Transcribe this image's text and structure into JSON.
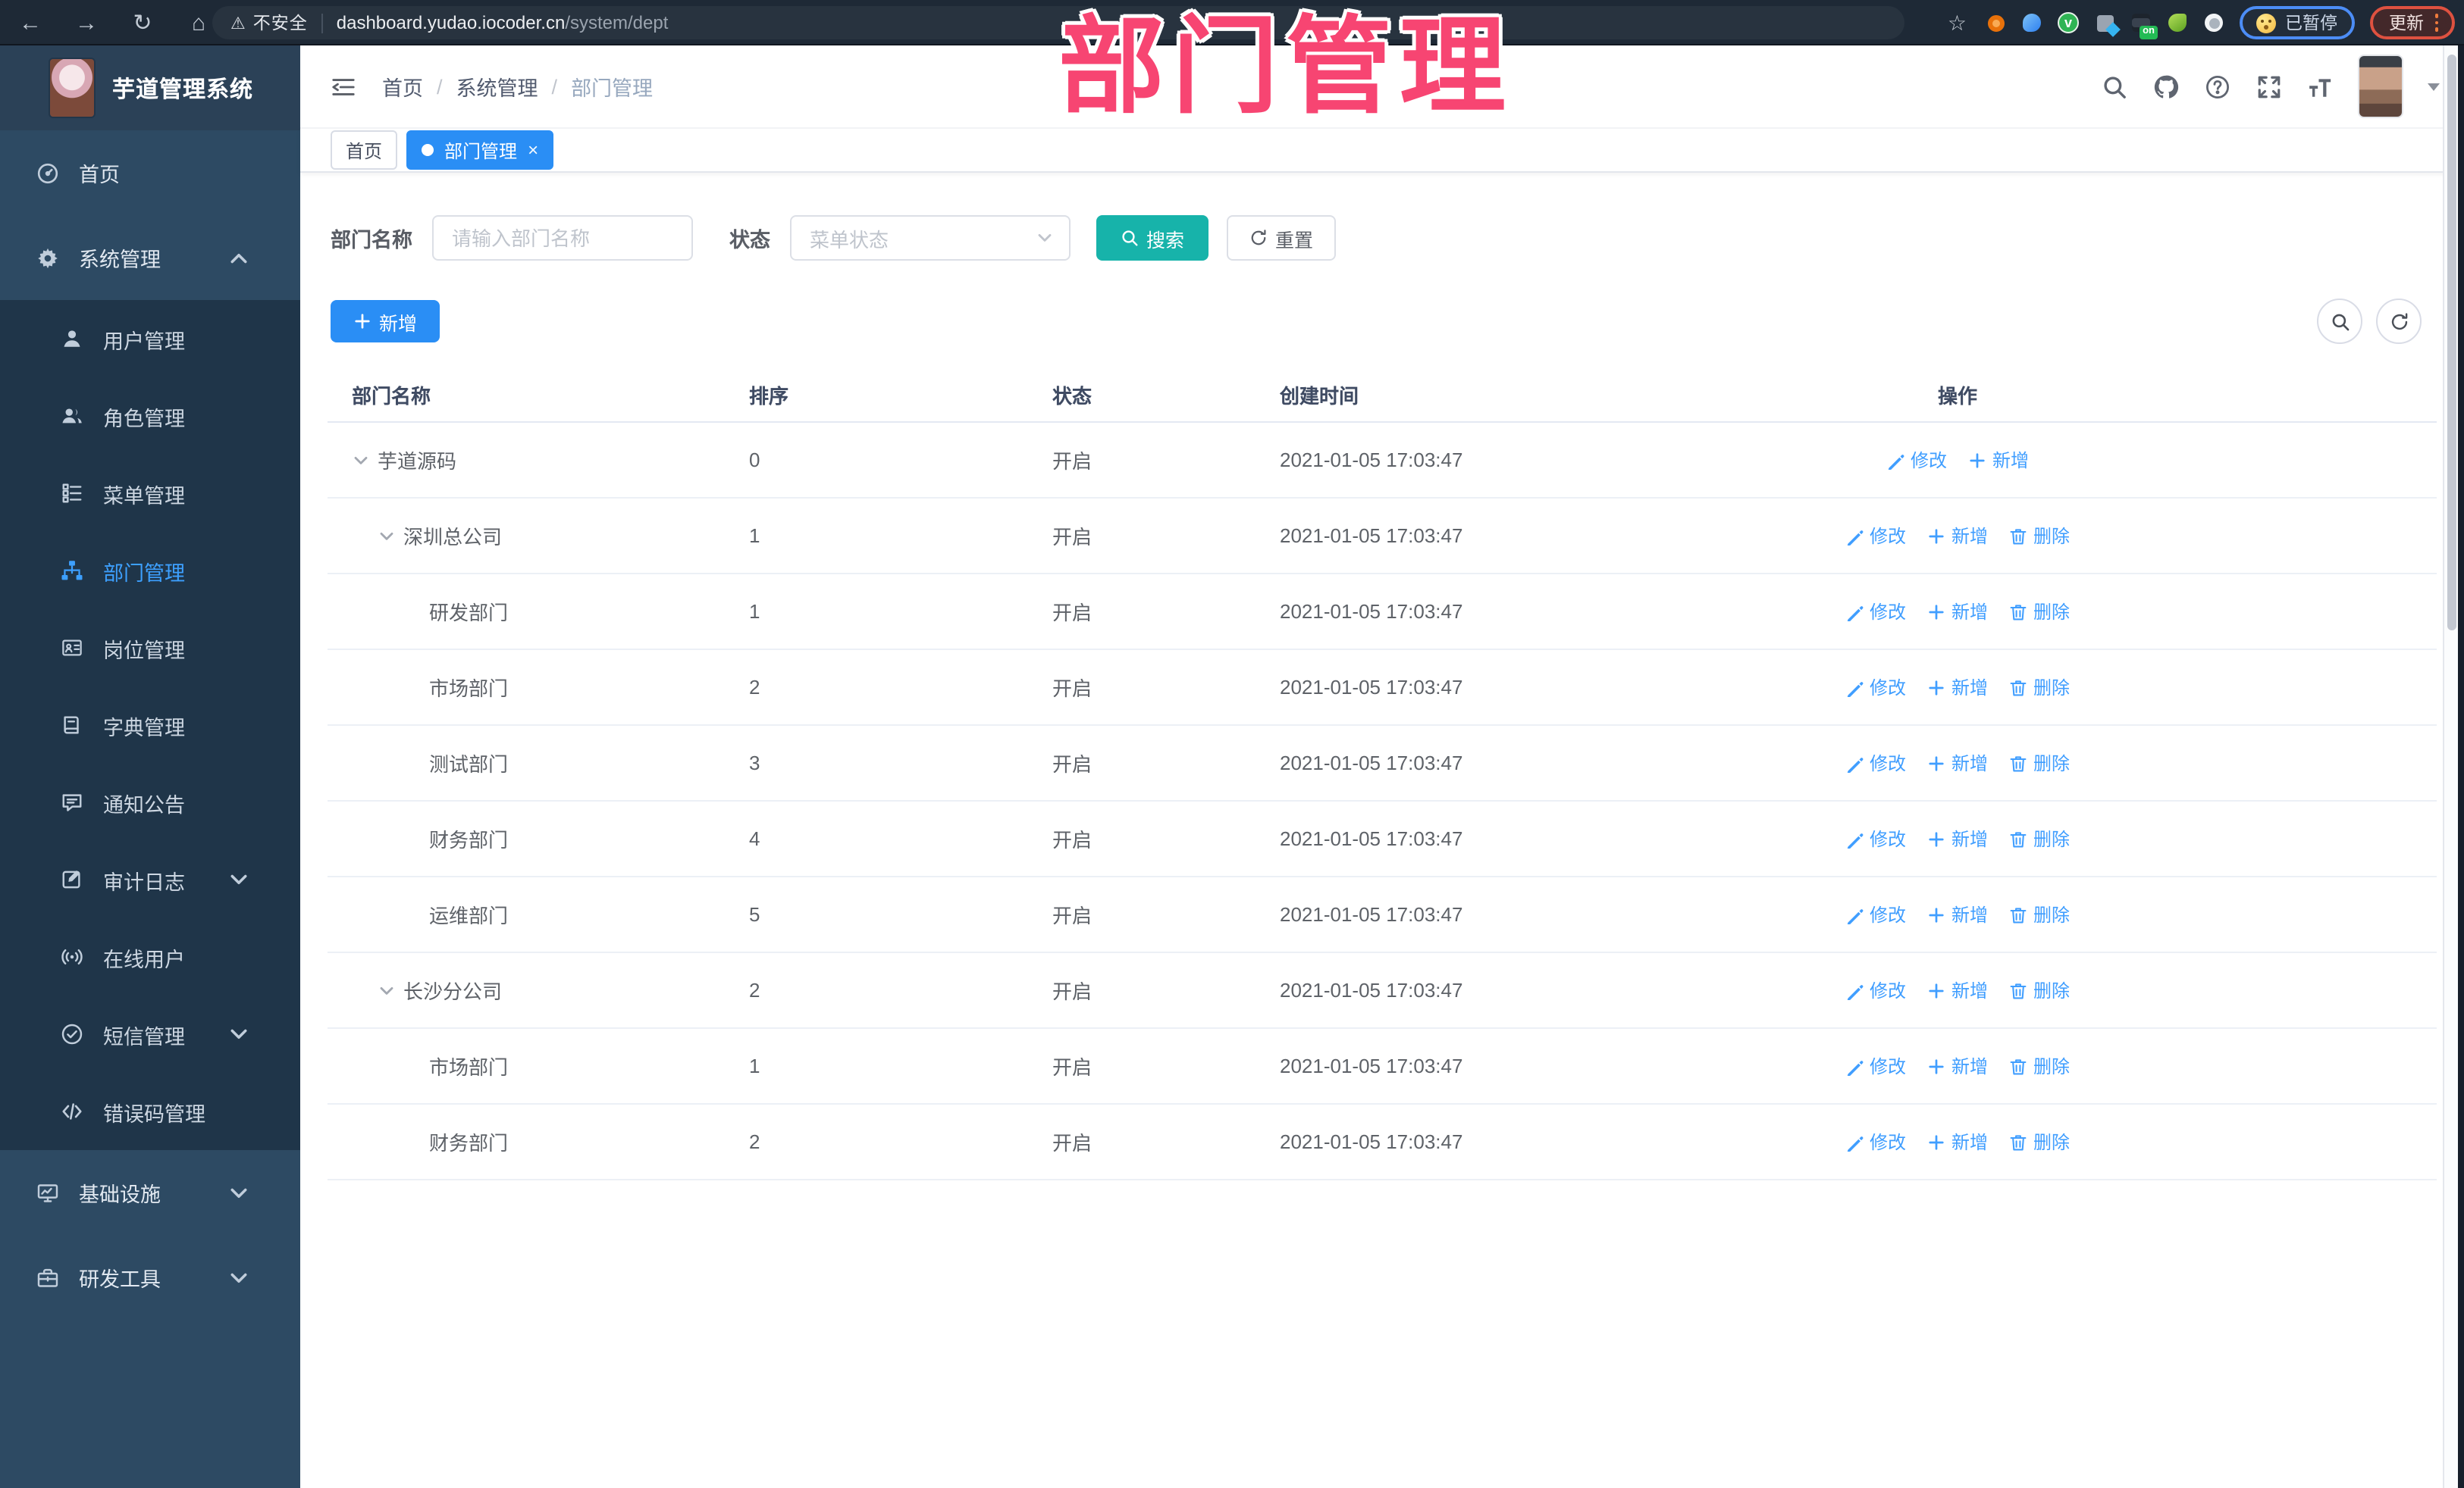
{
  "browser": {
    "security_label": "不安全",
    "url_host": "dashboard.yudao.iocoder.cn",
    "url_path": "/system/dept",
    "extensions": [
      "orange-ring-extension-icon",
      "blue-drop-extension-icon",
      "green-check-extension-icon",
      "grid-blue-extension-icon",
      "dark-on-extension-icon",
      "green-leaf-extension-icon",
      "white-paw-extension-icon"
    ],
    "on_badge": "on",
    "green_check_glyph": "v",
    "paused_label": "已暂停",
    "update_label": "更新"
  },
  "annotation": {
    "text": "部门管理",
    "color": "#f74572"
  },
  "sidebar": {
    "logo_title": "芋道管理系统",
    "items": [
      {
        "name": "home",
        "label": "首页",
        "icon": "dashboard-icon",
        "level": "top"
      },
      {
        "name": "system-management",
        "label": "系统管理",
        "icon": "gear-icon",
        "level": "top",
        "arrow": "up"
      },
      {
        "name": "user-management",
        "label": "用户管理",
        "icon": "user-icon",
        "level": "sub"
      },
      {
        "name": "role-management",
        "label": "角色管理",
        "icon": "users-icon",
        "level": "sub"
      },
      {
        "name": "menu-management",
        "label": "菜单管理",
        "icon": "menu-list-icon",
        "level": "sub"
      },
      {
        "name": "dept-management",
        "label": "部门管理",
        "icon": "org-tree-icon",
        "level": "sub",
        "active": true
      },
      {
        "name": "post-management",
        "label": "岗位管理",
        "icon": "badge-icon",
        "level": "sub"
      },
      {
        "name": "dict-management",
        "label": "字典管理",
        "icon": "dictionary-icon",
        "level": "sub"
      },
      {
        "name": "notice-announcement",
        "label": "通知公告",
        "icon": "announcement-icon",
        "level": "sub"
      },
      {
        "name": "audit-log",
        "label": "审计日志",
        "icon": "audit-log-icon",
        "level": "sub",
        "arrow": "down"
      },
      {
        "name": "online-users",
        "label": "在线用户",
        "icon": "online-user-icon",
        "level": "sub"
      },
      {
        "name": "sms-management",
        "label": "短信管理",
        "icon": "sms-icon",
        "level": "sub",
        "arrow": "down"
      },
      {
        "name": "error-code-management",
        "label": "错误码管理",
        "icon": "error-code-icon",
        "level": "sub"
      },
      {
        "name": "infrastructure",
        "label": "基础设施",
        "icon": "infrastructure-icon",
        "level": "top",
        "arrow": "down"
      },
      {
        "name": "dev-tools",
        "label": "研发工具",
        "icon": "dev-tools-icon",
        "level": "top",
        "arrow": "down"
      }
    ]
  },
  "header": {
    "breadcrumb": [
      "首页",
      "系统管理",
      "部门管理"
    ]
  },
  "tabs": [
    {
      "name": "home",
      "label": "首页",
      "active": false,
      "closable": false
    },
    {
      "name": "dept-management",
      "label": "部门管理",
      "active": true,
      "closable": true
    }
  ],
  "filters": {
    "dept_name_label": "部门名称",
    "dept_name_placeholder": "请输入部门名称",
    "status_label": "状态",
    "status_placeholder": "菜单状态",
    "search_label": "搜索",
    "reset_label": "重置"
  },
  "toolbar": {
    "add_label": "新增"
  },
  "table": {
    "columns": [
      "部门名称",
      "排序",
      "状态",
      "创建时间",
      "操作"
    ],
    "action_labels": {
      "edit": "修改",
      "add": "新增",
      "delete": "删除"
    },
    "rows": [
      {
        "name": "芋道源码",
        "level": 0,
        "expandable": true,
        "sort": "0",
        "status": "开启",
        "created": "2021-01-05 17:03:47",
        "actions": [
          "edit",
          "add"
        ]
      },
      {
        "name": "深圳总公司",
        "level": 1,
        "expandable": true,
        "sort": "1",
        "status": "开启",
        "created": "2021-01-05 17:03:47",
        "actions": [
          "edit",
          "add",
          "delete"
        ]
      },
      {
        "name": "研发部门",
        "level": 2,
        "expandable": false,
        "sort": "1",
        "status": "开启",
        "created": "2021-01-05 17:03:47",
        "actions": [
          "edit",
          "add",
          "delete"
        ]
      },
      {
        "name": "市场部门",
        "level": 2,
        "expandable": false,
        "sort": "2",
        "status": "开启",
        "created": "2021-01-05 17:03:47",
        "actions": [
          "edit",
          "add",
          "delete"
        ]
      },
      {
        "name": "测试部门",
        "level": 2,
        "expandable": false,
        "sort": "3",
        "status": "开启",
        "created": "2021-01-05 17:03:47",
        "actions": [
          "edit",
          "add",
          "delete"
        ]
      },
      {
        "name": "财务部门",
        "level": 2,
        "expandable": false,
        "sort": "4",
        "status": "开启",
        "created": "2021-01-05 17:03:47",
        "actions": [
          "edit",
          "add",
          "delete"
        ]
      },
      {
        "name": "运维部门",
        "level": 2,
        "expandable": false,
        "sort": "5",
        "status": "开启",
        "created": "2021-01-05 17:03:47",
        "actions": [
          "edit",
          "add",
          "delete"
        ]
      },
      {
        "name": "长沙分公司",
        "level": 1,
        "expandable": true,
        "sort": "2",
        "status": "开启",
        "created": "2021-01-05 17:03:47",
        "actions": [
          "edit",
          "add",
          "delete"
        ]
      },
      {
        "name": "市场部门",
        "level": 2,
        "expandable": false,
        "sort": "1",
        "status": "开启",
        "created": "2021-01-05 17:03:47",
        "actions": [
          "edit",
          "add",
          "delete"
        ]
      },
      {
        "name": "财务部门",
        "level": 2,
        "expandable": false,
        "sort": "2",
        "status": "开启",
        "created": "2021-01-05 17:03:47",
        "actions": [
          "edit",
          "add",
          "delete"
        ]
      }
    ]
  },
  "colors": {
    "accent_blue": "#2a8ef5",
    "link_blue": "#409eff",
    "teal": "#17b3aa",
    "sidebar_bg": "#2d4a63",
    "submenu_bg": "#1f3549",
    "annotation_pink": "#f74572",
    "chrome_bg": "#1e2936"
  }
}
